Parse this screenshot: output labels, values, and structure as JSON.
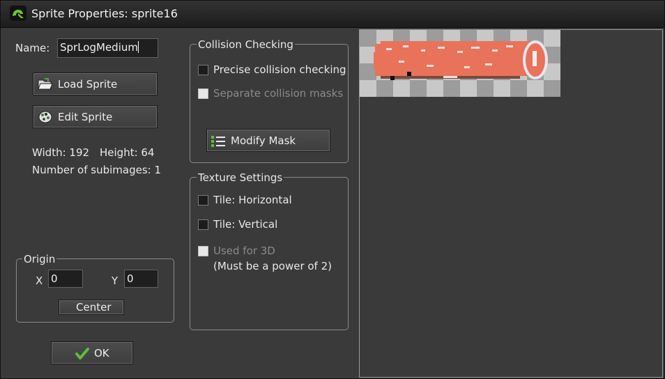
{
  "window": {
    "title": "Sprite Properties: sprite16"
  },
  "name_field": {
    "label": "Name:",
    "value": "SprLogMedium"
  },
  "buttons": {
    "load_sprite": "Load Sprite",
    "edit_sprite": "Edit Sprite",
    "modify_mask": "Modify Mask",
    "center": "Center",
    "ok": "OK"
  },
  "info": {
    "width": "Width: 192",
    "height": "Height: 64",
    "subimages": "Number of subimages: 1"
  },
  "origin": {
    "title": "Origin",
    "x_label": "X",
    "x_value": "0",
    "y_label": "Y",
    "y_value": "0"
  },
  "collision": {
    "title": "Collision Checking",
    "precise_label": "Precise collision checking",
    "precise_checked": false,
    "separate_label": "Separate collision masks",
    "separate_checked": false
  },
  "texture": {
    "title": "Texture Settings",
    "tile_h_label": "Tile: Horizontal",
    "tile_h_checked": false,
    "tile_v_label": "Tile: Vertical",
    "tile_v_checked": false,
    "used3d_label": "Used for 3D",
    "used3d_note": "(Must be a power of 2)",
    "used3d_checked": false
  },
  "colors": {
    "log_body": "#e8735a",
    "log_outline": "#5a2a1e",
    "log_end": "#e6e6f0",
    "checker_light": "#c8c8c8",
    "checker_dark": "#9c9c9c"
  },
  "icons": {
    "app": "gamemaker-logo-icon",
    "load": "folder-open-icon",
    "edit": "paint-palette-icon",
    "mask": "list-icon",
    "ok": "checkmark-icon"
  }
}
